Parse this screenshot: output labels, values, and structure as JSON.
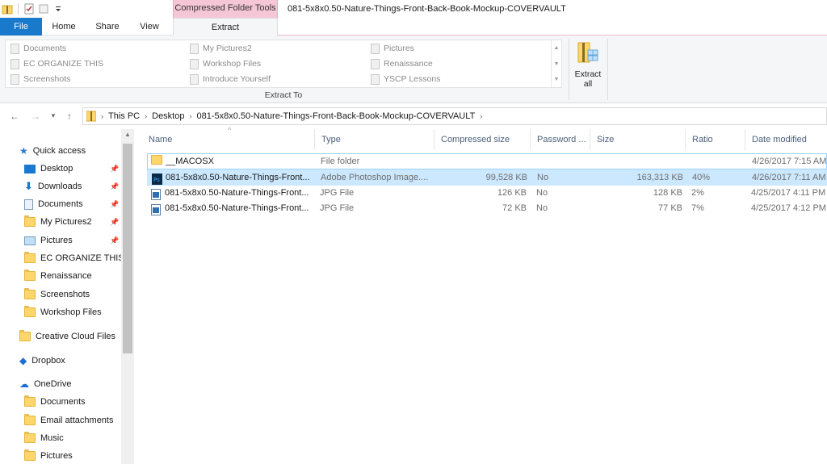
{
  "window": {
    "title": "081-5x8x0.50-Nature-Things-Front-Back-Book-Mockup-COVERVAULT",
    "context_tab_header": "Compressed Folder Tools"
  },
  "tabs": {
    "file": "File",
    "home": "Home",
    "share": "Share",
    "view": "View",
    "extract": "Extract"
  },
  "ribbon": {
    "extract_to": {
      "label": "Extract To",
      "items": [
        "Documents",
        "My Pictures2",
        "Pictures",
        "EC ORGANIZE THIS",
        "Workshop Files",
        "Renaissance",
        "Screenshots",
        "Introduce Yourself",
        "YSCP Lessons"
      ]
    },
    "extract_all_line1": "Extract",
    "extract_all_line2": "all"
  },
  "address": {
    "crumbs": [
      "This PC",
      "Desktop",
      "081-5x8x0.50-Nature-Things-Front-Back-Book-Mockup-COVERVAULT"
    ]
  },
  "nav": {
    "quick_access": "Quick access",
    "quick_items": [
      "Desktop",
      "Downloads",
      "Documents",
      "My Pictures2",
      "Pictures",
      "EC ORGANIZE THIS",
      "Renaissance",
      "Screenshots",
      "Workshop Files"
    ],
    "creative_cloud": "Creative Cloud Files",
    "dropbox": "Dropbox",
    "onedrive": "OneDrive",
    "onedrive_items": [
      "Documents",
      "Email attachments",
      "Music",
      "Pictures"
    ]
  },
  "columns": {
    "name": "Name",
    "type": "Type",
    "compressed": "Compressed size",
    "password": "Password ...",
    "size": "Size",
    "ratio": "Ratio",
    "date": "Date modified"
  },
  "files": [
    {
      "name": "__MACOSX",
      "type": "File folder",
      "compressed": "",
      "password": "",
      "size": "",
      "ratio": "",
      "date": "4/26/2017 7:15 AM"
    },
    {
      "name": "081-5x8x0.50-Nature-Things-Front...",
      "type": "Adobe Photoshop Image....",
      "compressed": "99,528 KB",
      "password": "No",
      "size": "163,313 KB",
      "ratio": "40%",
      "date": "4/26/2017 7:11 AM"
    },
    {
      "name": "081-5x8x0.50-Nature-Things-Front...",
      "type": "JPG File",
      "compressed": "126 KB",
      "password": "No",
      "size": "128 KB",
      "ratio": "2%",
      "date": "4/25/2017 4:11 PM"
    },
    {
      "name": "081-5x8x0.50-Nature-Things-Front...",
      "type": "JPG File",
      "compressed": "72 KB",
      "password": "No",
      "size": "77 KB",
      "ratio": "7%",
      "date": "4/25/2017 4:12 PM"
    }
  ],
  "colors": {
    "file_tab": "#1979ca",
    "context_pink": "#f4c6d6",
    "selection": "#cce8ff"
  }
}
